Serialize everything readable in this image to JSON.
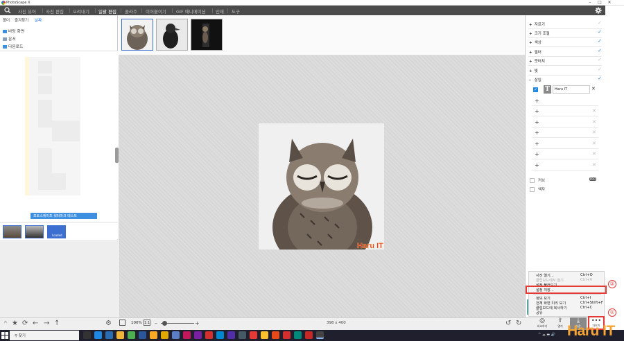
{
  "window": {
    "title": "PhotoScape X",
    "controls": [
      "–",
      "□",
      "✕"
    ]
  },
  "menubar": {
    "tabs": [
      {
        "label": "사진 뷰어",
        "active": false
      },
      {
        "label": "사진 편집",
        "active": false
      },
      {
        "label": "오려내기",
        "active": false
      },
      {
        "label": "일괄 편집",
        "active": true
      },
      {
        "label": "콜라주",
        "active": false
      },
      {
        "label": "이어붙이기",
        "active": false
      },
      {
        "label": "GIF 애니메이션",
        "active": false
      },
      {
        "label": "인쇄",
        "active": false
      },
      {
        "label": "도구",
        "active": false
      }
    ]
  },
  "leftpanel": {
    "tabs": [
      "폴더",
      "즐겨찾기",
      "날짜"
    ],
    "active_tab": "날짜",
    "folders": [
      "바탕 화면",
      "문서",
      "다운로드",
      "사진"
    ],
    "selected_folder": "포토스케이프 워터마크 테스트",
    "filmstrip_label": "Loaded"
  },
  "editor": {
    "watermark_text": "Haru IT",
    "zoom": "100%",
    "zoom_fit_label": "1:1",
    "image_size": "398 x 400"
  },
  "rightpanel": {
    "sections": [
      {
        "label": "자르기",
        "expander": "+",
        "checked": false
      },
      {
        "label": "크기 조절",
        "expander": "+",
        "checked": true
      },
      {
        "label": "색상",
        "expander": "+",
        "checked": true
      },
      {
        "label": "필터",
        "expander": "+",
        "checked": true
      },
      {
        "label": "붓터치",
        "expander": "+",
        "checked": false
      },
      {
        "label": "빛",
        "expander": "+",
        "checked": false
      },
      {
        "label": "삽입",
        "expander": "–",
        "checked": true
      }
    ],
    "insert_text_label": "Haru IT",
    "options": [
      {
        "label": "커브",
        "badge": "PRO"
      },
      {
        "label": "액자"
      }
    ]
  },
  "context_menu": {
    "items": [
      {
        "label": "사진 열기...",
        "shortcut": "Ctrl+O",
        "disabled": false
      },
      {
        "label": "클립보드에서 열기",
        "shortcut": "Ctrl+V",
        "disabled": true
      },
      {
        "label": "설정 불러오기...",
        "shortcut": "",
        "disabled": false
      },
      {
        "label": "설정 저장...",
        "shortcut": "",
        "disabled": false,
        "highlighted": true
      },
      {
        "label": "정보 보기",
        "shortcut": "Ctrl+I",
        "disabled": false
      },
      {
        "label": "전체 화면 미리 보기",
        "shortcut": "Ctrl+Shift+F",
        "disabled": false
      },
      {
        "label": "클립보드에 복사하기",
        "shortcut": "Ctrl+C",
        "disabled": false
      },
      {
        "label": "공유",
        "shortcut": "",
        "disabled": false
      }
    ]
  },
  "actions": [
    {
      "label": "비교하기",
      "icon": "compare-icon"
    },
    {
      "label": "열기",
      "icon": "upload-icon"
    },
    {
      "label": "저장",
      "icon": "download-icon"
    },
    {
      "label": "더보기",
      "icon": "more-icon"
    }
  ],
  "callouts": [
    "①",
    "②"
  ],
  "taskbar": {
    "search_placeholder": "찾기",
    "tray_text": "^ ☁ ▬ 🔊"
  },
  "brand": "Haru IT",
  "colors": {
    "menubar": "#4b4b4b",
    "accent": "#1e88e5",
    "callout": "#e53935",
    "watermark": "#e53935",
    "brand": "#f4a535"
  }
}
